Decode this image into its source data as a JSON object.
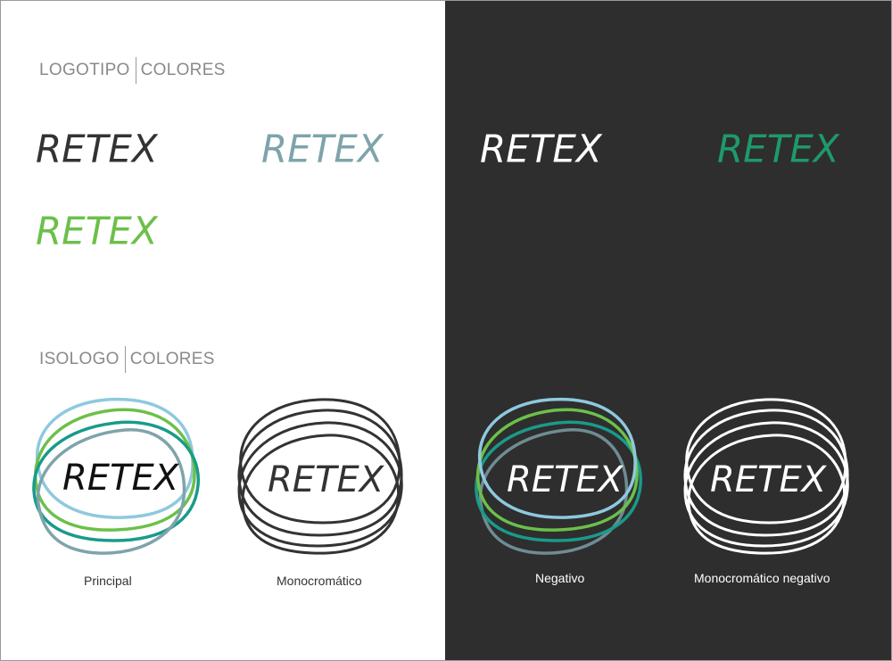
{
  "sections": {
    "logotipo": {
      "left": "LOGOTIPO",
      "right": "COLORES"
    },
    "isologo": {
      "left": "ISOLOGO",
      "right": "COLORES"
    }
  },
  "brand": "RETEX",
  "wordmarks": [
    {
      "text": "RETEX",
      "color": "#333333"
    },
    {
      "text": "RETEX",
      "color": "#7fa3ab"
    },
    {
      "text": "RETEX",
      "color": "#6cc04a"
    },
    {
      "text": "RETEX",
      "color": "#ffffff"
    },
    {
      "text": "RETEX",
      "color": "#1e9a6a"
    }
  ],
  "isologos": [
    {
      "text": "RETEX",
      "caption": "Principal",
      "text_color": "#111111",
      "ring_colors": [
        "#8ec9de",
        "#6cc04a",
        "#1a9a8a",
        "#7fa3ab"
      ]
    },
    {
      "text": "RETEX",
      "caption": "Monocromático",
      "text_color": "#333333",
      "ring_colors": [
        "#333333",
        "#333333",
        "#333333",
        "#333333"
      ]
    },
    {
      "text": "RETEX",
      "caption": "Negativo",
      "text_color": "#ffffff",
      "ring_colors": [
        "#8ec9de",
        "#6cc04a",
        "#1a9a8a",
        "#6f8c93"
      ]
    },
    {
      "text": "RETEX",
      "caption": "Monocromático negativo",
      "text_color": "#ffffff",
      "ring_colors": [
        "#ffffff",
        "#ffffff",
        "#ffffff",
        "#ffffff"
      ]
    }
  ],
  "colors": {
    "dark_panel": "#2e2e2e",
    "light_panel": "#ffffff",
    "title_gray": "#8a8a8a"
  }
}
